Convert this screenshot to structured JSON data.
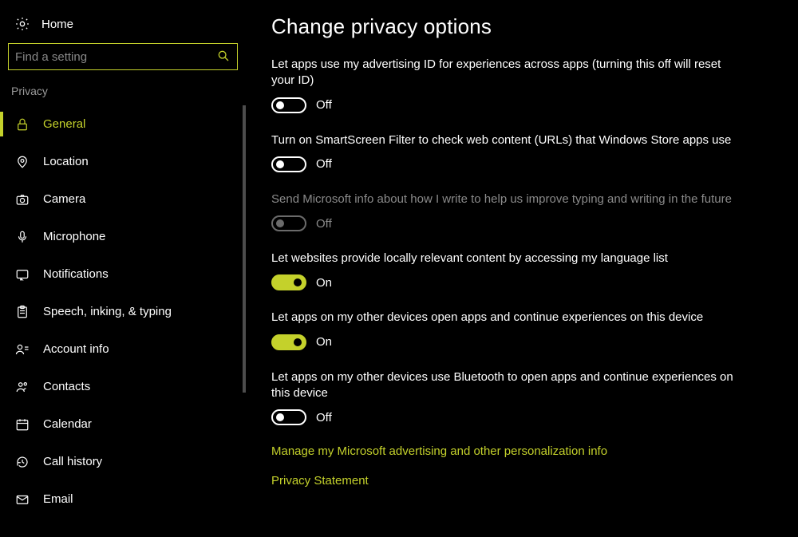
{
  "home_label": "Home",
  "search_placeholder": "Find a setting",
  "section_label": "Privacy",
  "nav": [
    {
      "id": "general",
      "label": "General",
      "active": true
    },
    {
      "id": "location",
      "label": "Location"
    },
    {
      "id": "camera",
      "label": "Camera"
    },
    {
      "id": "microphone",
      "label": "Microphone"
    },
    {
      "id": "notifications",
      "label": "Notifications"
    },
    {
      "id": "speech",
      "label": "Speech, inking, & typing"
    },
    {
      "id": "accountinfo",
      "label": "Account info"
    },
    {
      "id": "contacts",
      "label": "Contacts"
    },
    {
      "id": "calendar",
      "label": "Calendar"
    },
    {
      "id": "callhistory",
      "label": "Call history"
    },
    {
      "id": "email",
      "label": "Email"
    }
  ],
  "page_title": "Change privacy options",
  "toggle_state": {
    "on": "On",
    "off": "Off"
  },
  "settings": [
    {
      "desc": "Let apps use my advertising ID for experiences across apps (turning this off will reset your ID)",
      "on": false,
      "disabled": false
    },
    {
      "desc": "Turn on SmartScreen Filter to check web content (URLs) that Windows Store apps use",
      "on": false,
      "disabled": false
    },
    {
      "desc": "Send Microsoft info about how I write to help us improve typing and writing in the future",
      "on": false,
      "disabled": true
    },
    {
      "desc": "Let websites provide locally relevant content by accessing my language list",
      "on": true,
      "disabled": false
    },
    {
      "desc": "Let apps on my other devices open apps and continue experiences on this device",
      "on": true,
      "disabled": false
    },
    {
      "desc": "Let apps on my other devices use Bluetooth to open apps and continue experiences on this device",
      "on": false,
      "disabled": false
    }
  ],
  "links": {
    "manage": "Manage my Microsoft advertising and other personalization info",
    "privacy": "Privacy Statement"
  }
}
